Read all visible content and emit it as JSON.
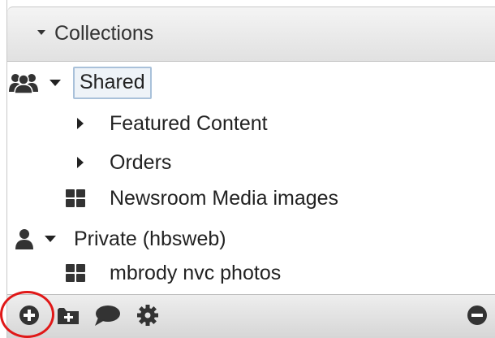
{
  "panel": {
    "header": {
      "title": "Collections"
    },
    "groups": [
      {
        "label": "Shared",
        "icon": "users-group-icon",
        "children": [
          {
            "label": "Featured Content",
            "icon": "caret-right-icon"
          },
          {
            "label": "Orders",
            "icon": "caret-right-icon"
          },
          {
            "label": "Newsroom Media images",
            "icon": "grid-icon"
          }
        ]
      },
      {
        "label": "Private (hbsweb)",
        "icon": "user-icon",
        "children": [
          {
            "label": "mbrody nvc photos",
            "icon": "grid-icon"
          }
        ]
      }
    ],
    "footer": {
      "icons": [
        "add-circle-icon",
        "add-folder-icon",
        "comment-icon",
        "gear-icon",
        "remove-circle-icon"
      ]
    }
  },
  "colors": {
    "selection_border": "#a9c1da",
    "highlight_ring": "#e01818"
  }
}
